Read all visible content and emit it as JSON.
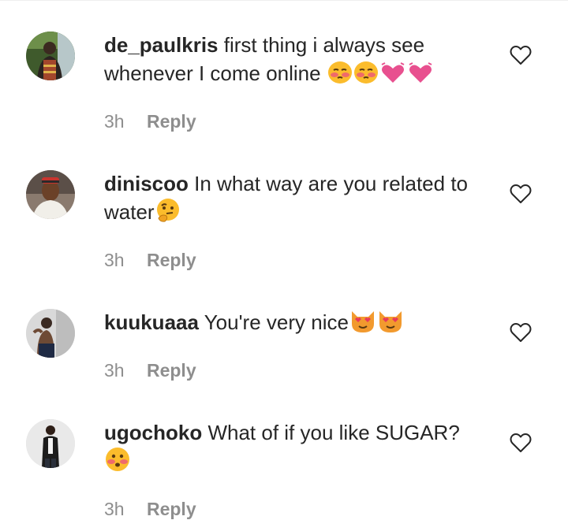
{
  "comments": [
    {
      "username": "de_paulkris",
      "text": "first thing i always see whenever I come online",
      "emojis": [
        "flushed-face",
        "flushed-face",
        "revolving-hearts",
        "revolving-hearts"
      ],
      "time": "3h",
      "reply_label": "Reply",
      "like_icon": "heart-outline-icon"
    },
    {
      "username": "diniscoo",
      "text": "In what way are you related to water",
      "emojis": [
        "thinking-face"
      ],
      "time": "3h",
      "reply_label": "Reply",
      "like_icon": "heart-outline-icon"
    },
    {
      "username": "kuukuaaa",
      "text": "You're very nice",
      "emojis": [
        "heart-eyes-cat",
        "heart-eyes-cat"
      ],
      "time": "3h",
      "reply_label": "Reply",
      "like_icon": "heart-outline-icon"
    },
    {
      "username": "ugochoko",
      "text": "What of if you like SUGAR?",
      "emojis": [
        "flushed-face"
      ],
      "time": "3h",
      "reply_label": "Reply",
      "like_icon": "heart-outline-icon"
    }
  ],
  "colors": {
    "text": "#262626",
    "meta": "#8e8e8e",
    "emoji_yellow": "#fbbc2c",
    "heart_pink": "#e8508f",
    "cat_orange": "#f29a2e"
  }
}
